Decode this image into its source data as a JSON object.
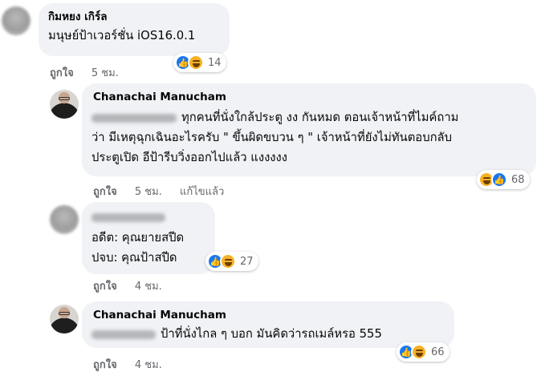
{
  "comments": [
    {
      "author": "กิมหยง เกิร์ล",
      "text": [
        "มนุษย์ป้าเวอร์ชั่น iOS16.0.1"
      ],
      "reactions": [
        "like",
        "haha"
      ],
      "reaction_count": "14",
      "like_label": "ถูกใจ",
      "time": "5 ชม.",
      "edited": ""
    },
    {
      "author": "Chanachai Manucham",
      "text": [
        "ทุกคนที่นั่งใกล้ประตู งง กันหมด ตอนเจ้าหน้าที่ไมค์ถาม",
        "ว่า มีเหตุฉุกเฉินอะไรครับ \" ขึ้นผิดขบวน ๆ \" เจ้าหน้าที่ยังไม่ทันตอบกลับ",
        "ประตูเปิด อีป้ารีบวิ่งออกไปแล้ว แงงงงง"
      ],
      "reactions": [
        "haha",
        "like"
      ],
      "reaction_count": "68",
      "like_label": "ถูกใจ",
      "time": "5 ชม.",
      "edited": "แก้ไขแล้ว"
    },
    {
      "author": "",
      "text": [
        "อดีต: คุณยายสปีด",
        "ปจบ: คุณป้าสปีด"
      ],
      "reactions": [
        "like",
        "haha"
      ],
      "reaction_count": "27",
      "like_label": "ถูกใจ",
      "time": "4 ชม.",
      "edited": ""
    },
    {
      "author": "Chanachai Manucham",
      "text": [
        "ป้าที่นั่งไกล ๆ บอก มันคิดว่ารถเมล์หรอ 555"
      ],
      "reactions": [
        "like",
        "haha"
      ],
      "reaction_count": "66",
      "like_label": "ถูกใจ",
      "time": "4 ชม.",
      "edited": ""
    }
  ],
  "colors": {
    "bubble": "#f0f2f5",
    "secondary_text": "#65676b",
    "like_blue": "#1877f2",
    "haha_yellow": "#f7b125"
  },
  "icons": {
    "like": "thumbs-up-icon",
    "haha": "laughing-face-icon"
  }
}
